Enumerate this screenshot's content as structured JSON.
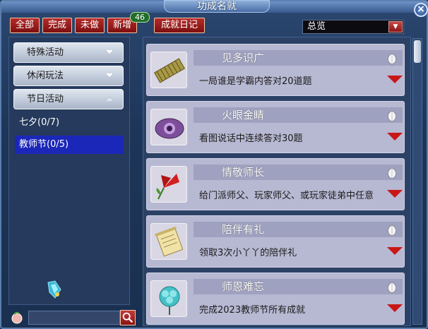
{
  "window": {
    "title": "功成名就"
  },
  "filters": [
    {
      "label": "全部"
    },
    {
      "label": "完成"
    },
    {
      "label": "未做"
    },
    {
      "label": "新增",
      "badge": "46"
    },
    {
      "label": "成就日记"
    }
  ],
  "dropdown": {
    "selected": "总览"
  },
  "sidebar": {
    "categories": [
      {
        "label": "特殊活动",
        "state": "collapsed"
      },
      {
        "label": "休闲玩法",
        "state": "collapsed"
      },
      {
        "label": "节日活动",
        "state": "expanded"
      }
    ],
    "sub_items": [
      {
        "label": "七夕(0/7)",
        "selected": false
      },
      {
        "label": "教师节(0/5)",
        "selected": true
      }
    ]
  },
  "search": {
    "placeholder": "",
    "value": ""
  },
  "achievements": [
    {
      "name": "见多识广",
      "desc": "一局谁是学霸内答对20道题",
      "icon": "scroll-bundle-icon"
    },
    {
      "name": "火眼金睛",
      "desc": "看图说话中连续答对30题",
      "icon": "purple-eye-icon"
    },
    {
      "name": "情敬师长",
      "desc": "给门派师父、玩家师父、或玩家徒弟中任意",
      "icon": "red-flower-icon"
    },
    {
      "name": "陪伴有礼",
      "desc": "领取3次小丫丫的陪伴礼",
      "icon": "paper-scroll-icon"
    },
    {
      "name": "师恩难忘",
      "desc": "完成2023教师节所有成就",
      "icon": "teal-flower-icon"
    }
  ],
  "colors": {
    "accent_red": "#b62b2b",
    "selected_blue": "#1b27b8",
    "card_bg": "#b7b8d2"
  }
}
